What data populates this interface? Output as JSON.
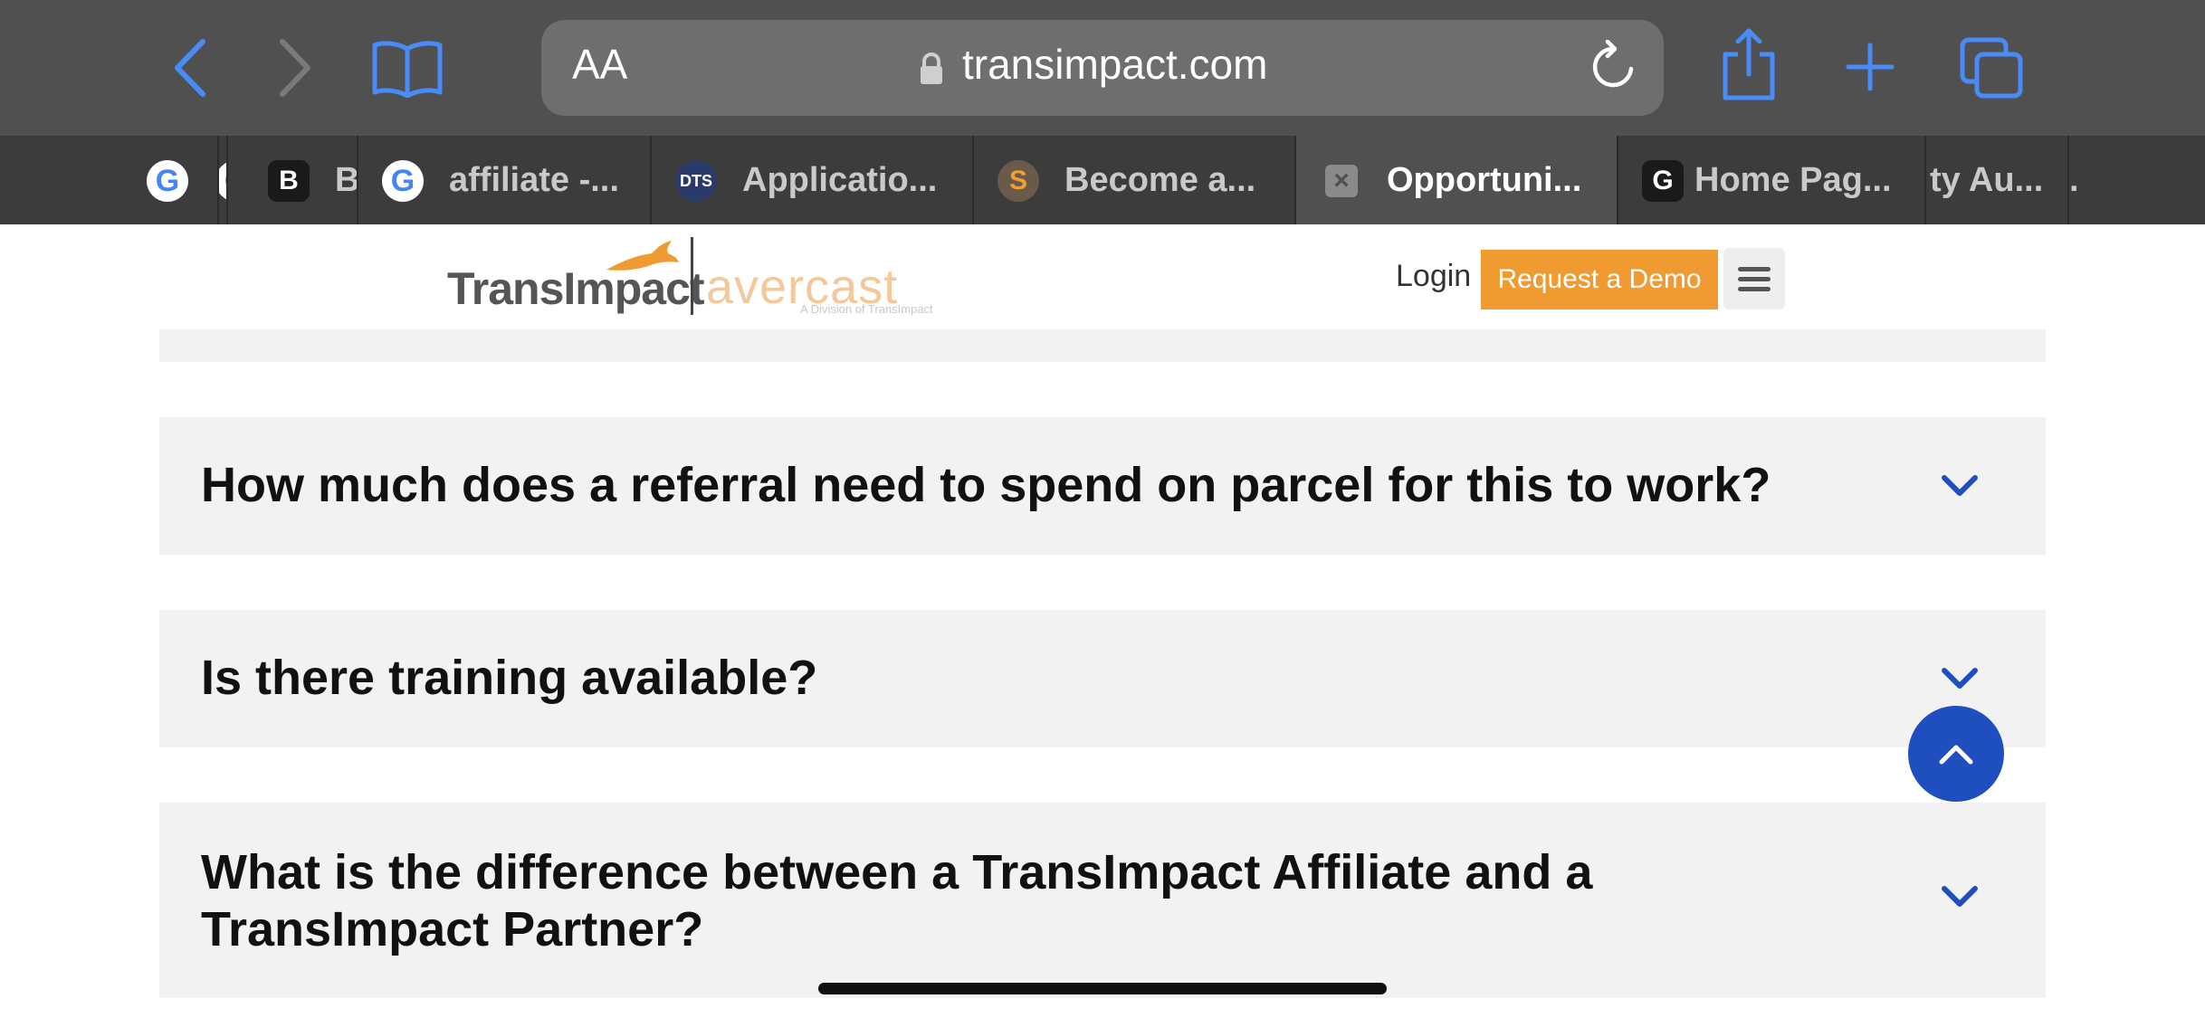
{
  "browser": {
    "address_bar": {
      "reader_label": "AA",
      "url": "transimpact.com"
    },
    "toolbar_icons": [
      "back-icon",
      "forward-icon",
      "bookmarks-icon",
      "lock-icon",
      "reload-icon",
      "share-icon",
      "new-tab-icon",
      "tabs-icon"
    ],
    "tabs": [
      {
        "favicon": "google-icon",
        "label": ""
      },
      {
        "favicon": "google-icon",
        "label": ""
      },
      {
        "favicon": "B",
        "label": "B"
      },
      {
        "favicon": "google-icon",
        "label": "affiliate -..."
      },
      {
        "favicon": "DTS",
        "label": "Applicatio..."
      },
      {
        "favicon": "S",
        "label": "Become a..."
      },
      {
        "favicon": "×",
        "label": "Opportuni...",
        "active": true
      },
      {
        "favicon": "G",
        "label": "Home Pag..."
      },
      {
        "favicon": "",
        "label": "ty Au..."
      },
      {
        "favicon": "",
        "label": "."
      }
    ]
  },
  "site": {
    "logo": {
      "primary": "TransImpact",
      "secondary": "avercast",
      "secondary_sub": "A Division of TransImpact"
    },
    "nav": {
      "login": "Login",
      "demo_button": "Request a Demo"
    }
  },
  "faq": [
    {
      "question": "How much does a referral need to spend on parcel for this to work?"
    },
    {
      "question": "Is there training available?"
    },
    {
      "question": "What is the difference between a TransImpact Affiliate and a TransImpact Partner?"
    }
  ],
  "colors": {
    "accent_blue": "#1f4fbf",
    "demo_orange": "#f09a32",
    "safari_blue": "#4a8cf7"
  }
}
